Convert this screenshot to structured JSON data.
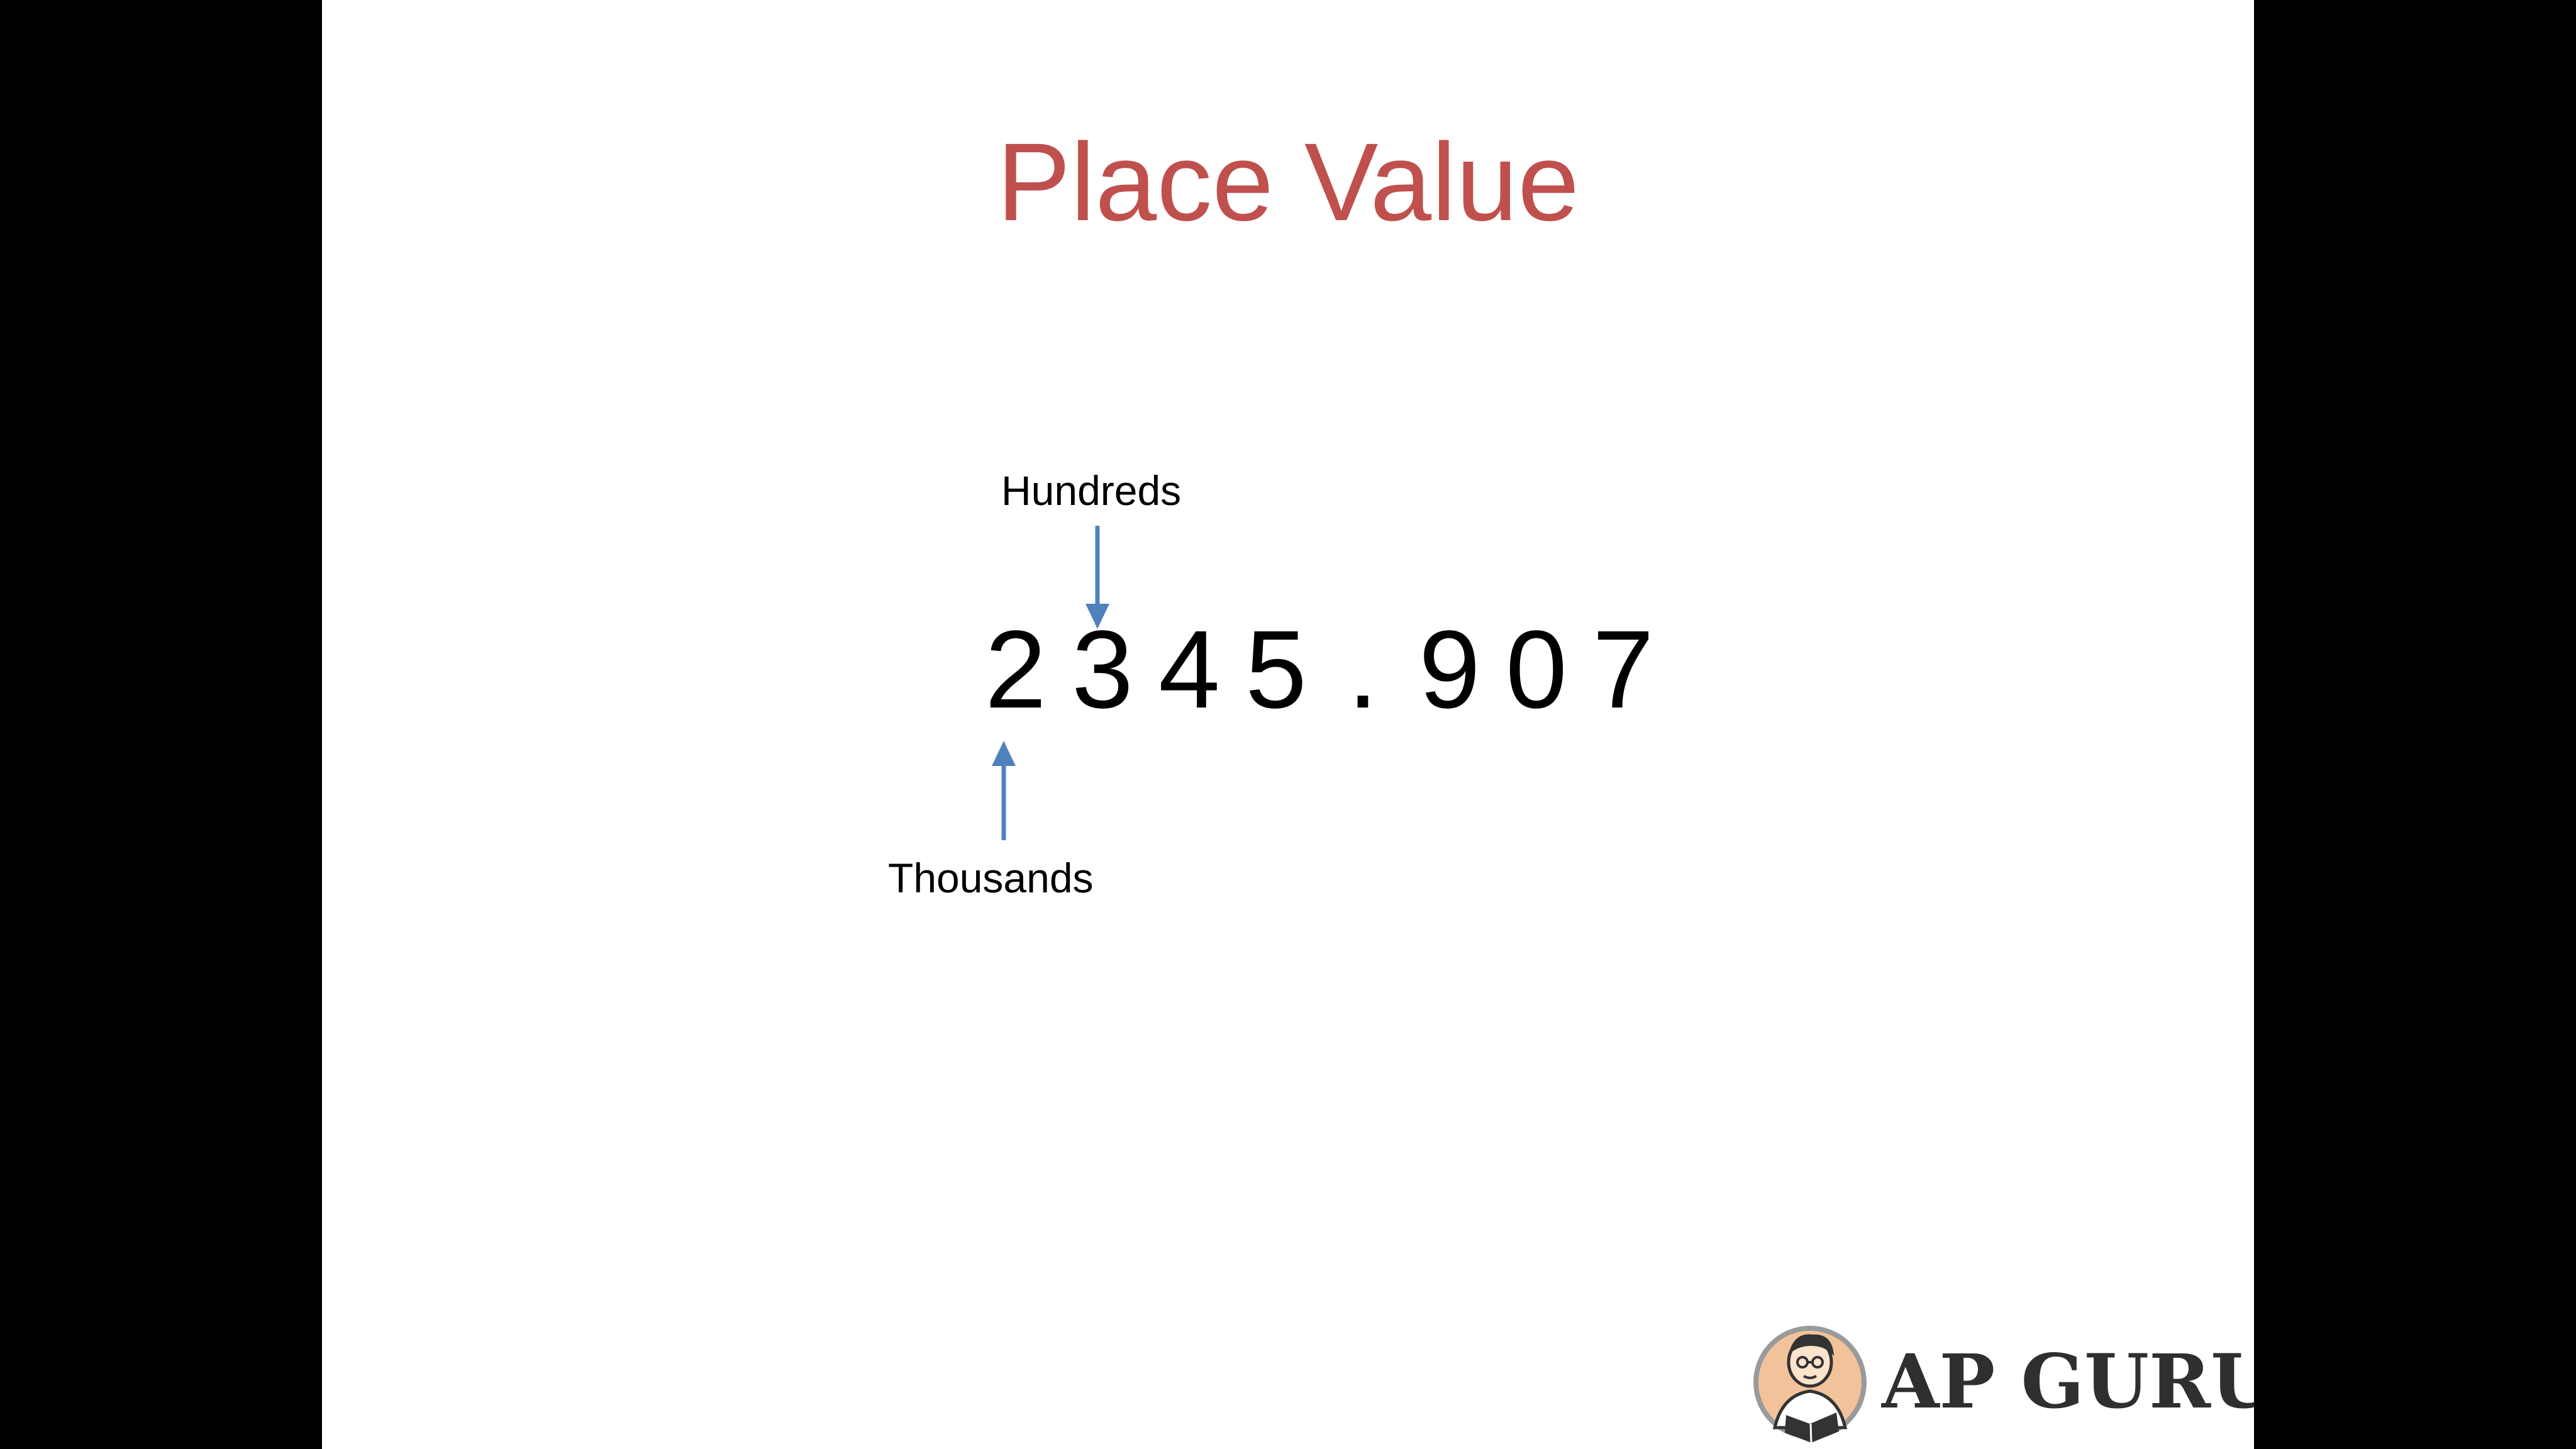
{
  "slide": {
    "title": "Place Value",
    "title_color": "#c0504d",
    "digits": [
      "2",
      "3",
      "4",
      "5",
      ".",
      "9",
      "0",
      "7"
    ],
    "labels": {
      "hundreds": "Hundreds",
      "thousands": "Thousands"
    },
    "arrow_color": "#4f81bd"
  },
  "logo": {
    "text": "AP GURU",
    "icon": "reading-guru-mascot-icon"
  }
}
